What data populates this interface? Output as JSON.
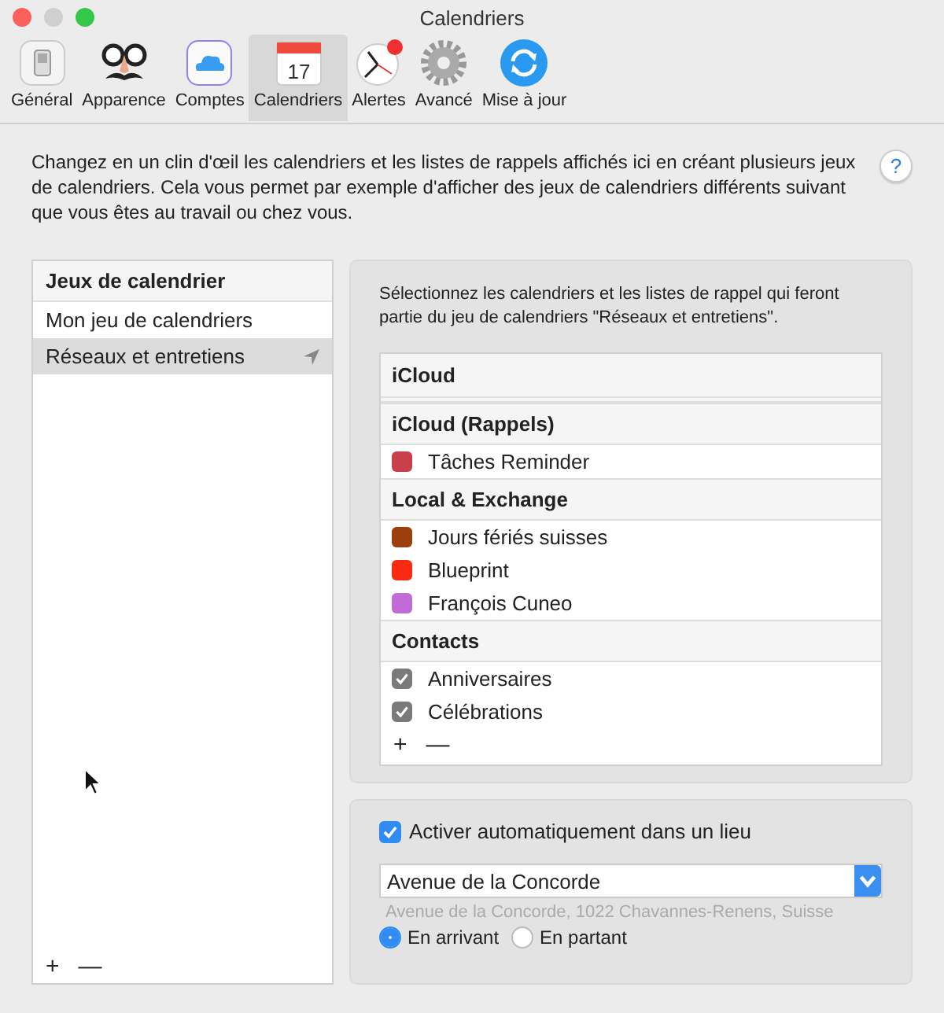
{
  "window": {
    "title": "Calendriers"
  },
  "tabs": [
    {
      "label": "Général",
      "selected": false
    },
    {
      "label": "Apparence",
      "selected": false
    },
    {
      "label": "Comptes",
      "selected": false
    },
    {
      "label": "Calendriers",
      "selected": true
    },
    {
      "label": "Alertes",
      "selected": false
    },
    {
      "label": "Avancé",
      "selected": false
    },
    {
      "label": "Mise à jour",
      "selected": false
    }
  ],
  "calendar_icon_day": "17",
  "description": "Changez en un clin d'œil les calendriers et les listes de rappels affichés ici en créant plusieurs jeux de calendriers. Cela vous permet par exemple d'afficher des jeux de calendriers différents suivant que vous êtes au travail ou chez vous.",
  "help_button": "?",
  "sets": {
    "heading": "Jeux de calendrier",
    "items": [
      {
        "label": "Mon jeu de calendriers",
        "selected": false
      },
      {
        "label": "Réseaux et entretiens",
        "selected": true
      }
    ],
    "add": "+",
    "remove": "—"
  },
  "calendars": {
    "instructions": "Sélectionnez les calendriers et les listes de rappel qui feront partie du jeu de calendriers \"Réseaux et entretiens\".",
    "rows": [
      {
        "kind": "group",
        "label": "iCloud"
      },
      {
        "kind": "group",
        "label": "iCloud (Rappels)"
      },
      {
        "kind": "color",
        "label": "Tâches Reminder",
        "color": "#c8404a"
      },
      {
        "kind": "group",
        "label": "Local & Exchange"
      },
      {
        "kind": "color",
        "label": "Jours fériés suisses",
        "color": "#9c3f0a"
      },
      {
        "kind": "color",
        "label": "Blueprint",
        "color": "#f82a12"
      },
      {
        "kind": "color",
        "label": "François Cuneo",
        "color": "#c26ad8"
      },
      {
        "kind": "group",
        "label": "Contacts"
      },
      {
        "kind": "checkbox",
        "label": "Anniversaires",
        "checked": true
      },
      {
        "kind": "checkbox",
        "label": "Célébrations",
        "checked": true
      }
    ],
    "add": "+",
    "remove": "—"
  },
  "location": {
    "enabled": true,
    "label": "Activer automatiquement dans un lieu",
    "value": "Avenue de la Concorde",
    "address": "Avenue de la Concorde, 1022 Chavannes-Renens, Suisse",
    "options": [
      {
        "label": "En arrivant",
        "selected": true
      },
      {
        "label": "En partant",
        "selected": false
      }
    ]
  }
}
